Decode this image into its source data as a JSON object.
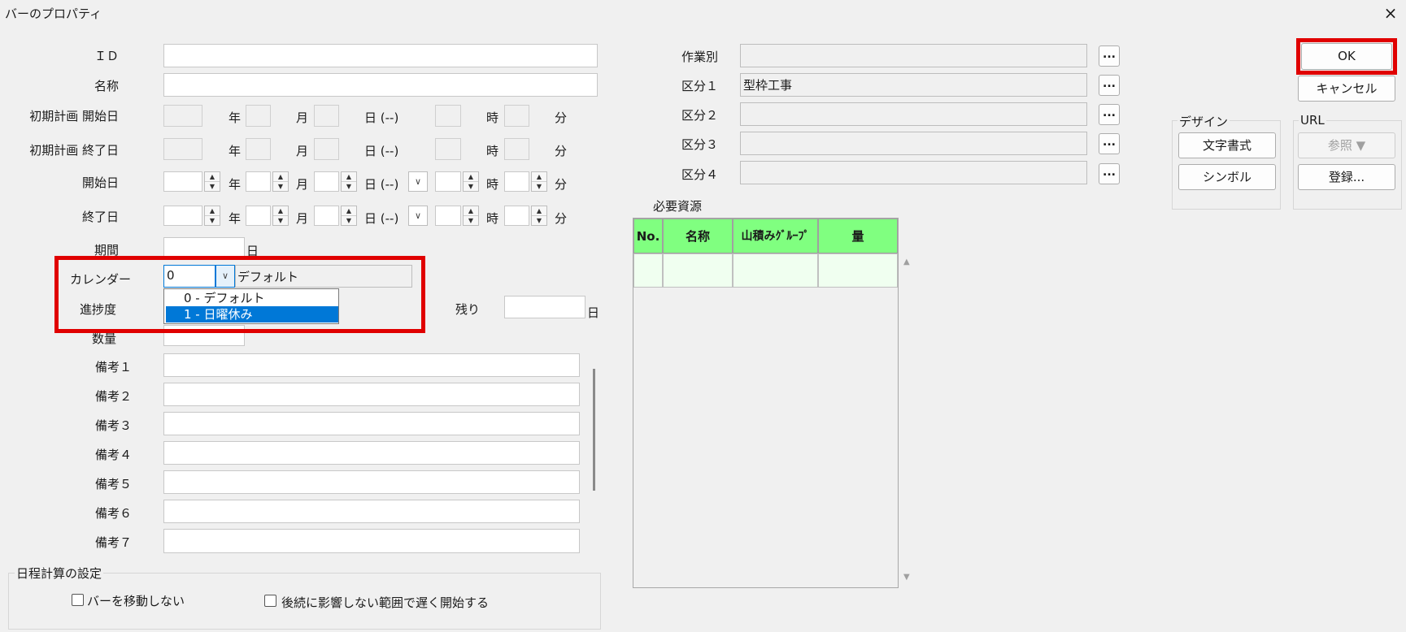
{
  "window": {
    "title": "バーのプロパティ",
    "close_icon": "×"
  },
  "left": {
    "id_label": "ＩＤ",
    "name_label": "名称",
    "plan_start_label": "初期計画 開始日",
    "plan_end_label": "初期計画 終了日",
    "start_label": "開始日",
    "end_label": "終了日",
    "period_label": "期間",
    "calendar_label": "カレンダー",
    "progress_label": "進捗度",
    "quantity_label": "数量",
    "remaining_label": "残り",
    "unit_year": "年",
    "unit_month": "月",
    "unit_day_dow": "日 (--)",
    "unit_hour": "時",
    "unit_minute": "分",
    "unit_day": "日",
    "notes": [
      "備考１",
      "備考２",
      "備考３",
      "備考４",
      "備考５",
      "備考６",
      "備考７"
    ]
  },
  "calendar": {
    "value": "0",
    "name": "デフォルト",
    "options": [
      "0 - デフォルト",
      "1 - 日曜休み"
    ],
    "selected_index": 1
  },
  "schedule": {
    "title": "日程計算の設定",
    "dont_move": "バーを移動しない",
    "late_start": "後続に影響しない範囲で遅く開始する"
  },
  "middle": {
    "work_label": "作業別",
    "cat1_label": "区分１",
    "cat1_value": "型枠工事",
    "cat2_label": "区分２",
    "cat3_label": "区分３",
    "cat4_label": "区分４",
    "ellipsis": "...",
    "resources_label": "必要資源",
    "table_headers": [
      "No.",
      "名称",
      "山積みｸﾞﾙｰﾌﾟ",
      "量"
    ]
  },
  "right": {
    "ok": "OK",
    "cancel": "キャンセル",
    "design_title": "デザイン",
    "text_style": "文字書式",
    "symbol": "シンボル",
    "url_title": "URL",
    "browse": "参照 ▼",
    "register": "登録..."
  },
  "colors": {
    "highlight": "#e00000",
    "table_header": "#80ff80",
    "selection": "#0078d7"
  }
}
